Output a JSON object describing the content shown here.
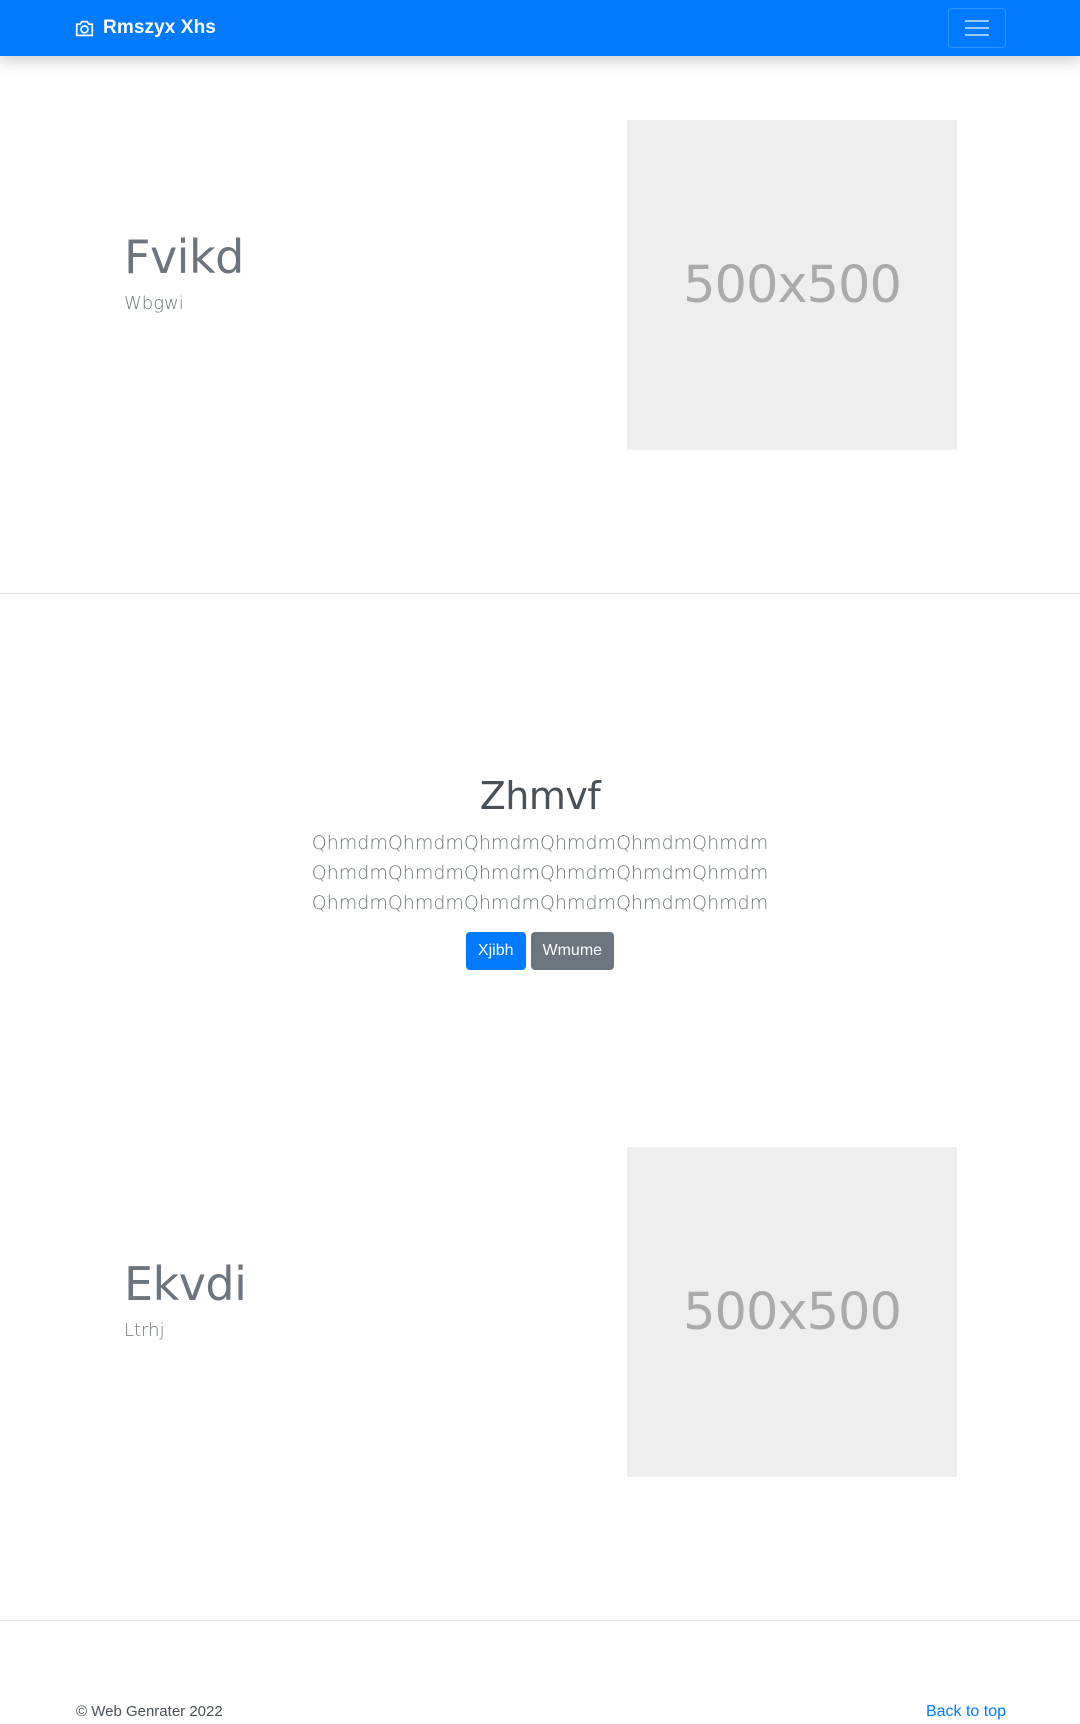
{
  "navbar": {
    "brand_name": "Rmszyx Xhs",
    "brand_icon": "camera-icon",
    "toggler_icon": "hamburger-menu-icon",
    "background": "#007bff"
  },
  "features": [
    {
      "title": "Fvikd",
      "subtitle": "Wbgwi",
      "image_label": "500x500"
    },
    {
      "title": "Ekvdi",
      "subtitle": "Ltrhj",
      "image_label": "500x500"
    }
  ],
  "hero": {
    "title": "Zhmvf",
    "lines": [
      "QhmdmQhmdmQhmdmQhmdmQhmdmQhmdm",
      "QhmdmQhmdmQhmdmQhmdmQhmdmQhmdm",
      "QhmdmQhmdmQhmdmQhmdmQhmdmQhmdm"
    ],
    "primary_button": "Xjibh",
    "secondary_button": "Wmume"
  },
  "footer": {
    "copyright": "© Web Genrater 2022",
    "back_to_top": "Back to top"
  },
  "colors": {
    "primary": "#007bff",
    "secondary": "#6c757d",
    "placeholder_bg": "#eeeeee"
  }
}
